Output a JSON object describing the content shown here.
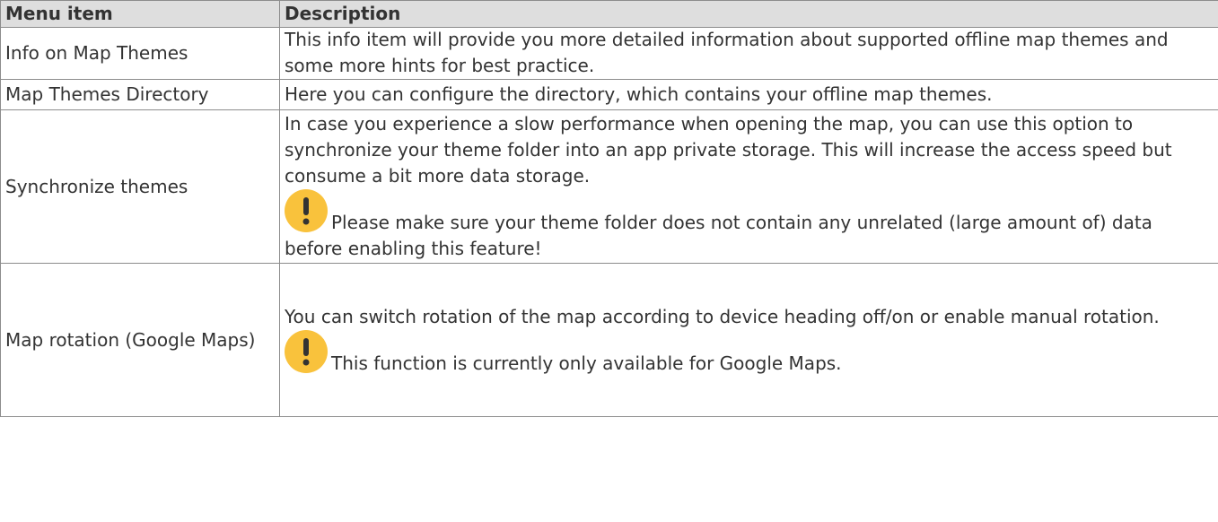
{
  "table": {
    "headers": [
      "Menu item",
      "Description"
    ],
    "rows": [
      {
        "item": "Info on Map Themes",
        "description": "This info item will provide you more detailed information about supported offline map themes and some more hints for best practice."
      },
      {
        "item": "Map Themes Directory",
        "description": "Here you can configure the directory, which contains your offline map themes."
      },
      {
        "item": "Synchronize themes",
        "description": "In case you experience a slow performance when opening the map, you can use this option to synchronize your theme folder into an app private storage. This will increase the access speed but consume a bit more data storage.",
        "notice": "Please make sure your theme folder does not contain any unrelated (large amount of) data before enabling this feature!",
        "notice_icon": "exclamation-icon"
      },
      {
        "item": "Map rotation (Google Maps)",
        "description": "You can switch rotation of the map according to device heading off/on or enable manual rotation.",
        "notice": "This function is currently only available for Google Maps.",
        "notice_icon": "exclamation-icon"
      }
    ]
  },
  "colors": {
    "header_bg": "#dedede",
    "border": "#8c8c8c",
    "notice_icon": "#f9c23c"
  }
}
